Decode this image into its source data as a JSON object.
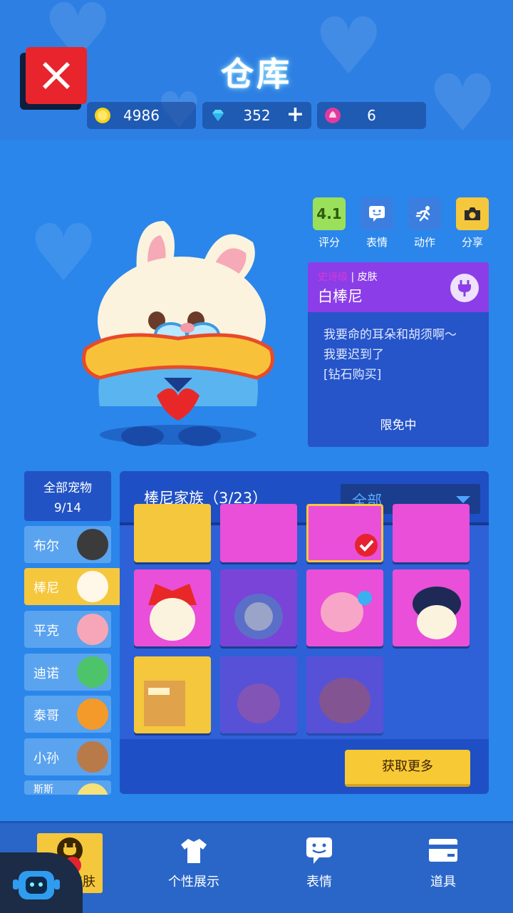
{
  "header": {
    "title": "仓库"
  },
  "currencies": [
    {
      "icon": "gold-coin-icon",
      "value": "4986"
    },
    {
      "icon": "diamond-icon",
      "value": "352",
      "plus": "+"
    },
    {
      "icon": "lotus-token-icon",
      "value": "6"
    }
  ],
  "actions": [
    {
      "id": "rating",
      "badge": "4.1",
      "label": "评分",
      "color": "#9be05a"
    },
    {
      "id": "emote",
      "label": "表情",
      "color": "#3c7ee0"
    },
    {
      "id": "motion",
      "label": "动作",
      "color": "#3c7ee0"
    },
    {
      "id": "share",
      "label": "分享",
      "color": "#f5c73d"
    }
  ],
  "skin": {
    "rarity": "史诗级",
    "type": "皮肤",
    "name": "白棒尼",
    "desc_lines": [
      "我要命的耳朵和胡须啊～",
      "我要迟到了",
      "[钻石购买]"
    ],
    "status": "限免中"
  },
  "pet_list": {
    "all_label": "全部宠物",
    "all_count": "9/14",
    "items": [
      {
        "name": "布尔",
        "color": "#3b3b3b"
      },
      {
        "name": "棒尼",
        "color": "#fff7e8",
        "active": true
      },
      {
        "name": "平克",
        "color": "#f7a6b8"
      },
      {
        "name": "迪诺",
        "color": "#4ec46a"
      },
      {
        "name": "泰哥",
        "color": "#f49a2a"
      },
      {
        "name": "小孙",
        "color": "#b87a48"
      },
      {
        "name": "斯斯",
        "color": "#f5e27a"
      }
    ]
  },
  "family": {
    "title": "棒尼家族（3/23）",
    "filter": "全部",
    "more_button": "获取更多"
  },
  "bottom_nav": [
    {
      "id": "pet-skin",
      "label": "宠物皮肤",
      "icon": "plug-icon",
      "active": true
    },
    {
      "id": "profile",
      "label": "个性展示",
      "icon": "shirt-icon"
    },
    {
      "id": "emote",
      "label": "表情",
      "icon": "chat-face-icon"
    },
    {
      "id": "items",
      "label": "道具",
      "icon": "card-icon"
    }
  ],
  "colors": {
    "accent_yellow": "#f5c73d",
    "epic_purple": "#8b3ee8",
    "panel_blue": "#1f4fc4",
    "close_red": "#e8242d"
  }
}
